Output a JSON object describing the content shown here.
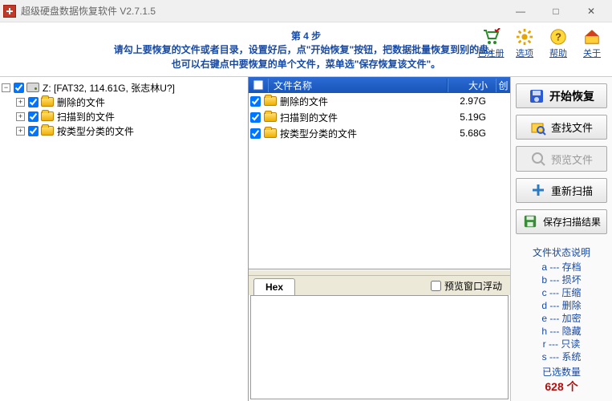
{
  "window": {
    "title": "超级硬盘数据恢复软件 V2.7.1.5",
    "min": "—",
    "max": "□",
    "close": "✕"
  },
  "step": {
    "label": "第 4 步"
  },
  "instructions": {
    "line1": "请勾上要恢复的文件或者目录，设置好后，点\"开始恢复\"按钮，把数据批量恢复到别的盘。",
    "line2": "也可以右键点中要恢复的单个文件，菜单选\"保存恢复该文件\"。"
  },
  "top_tools": [
    {
      "id": "registered",
      "label": "已注册"
    },
    {
      "id": "options",
      "label": "选项"
    },
    {
      "id": "help",
      "label": "帮助"
    },
    {
      "id": "about",
      "label": "关于"
    }
  ],
  "tree": {
    "root": {
      "label": "Z:  [FAT32, 114.61G, 张志林U?]"
    },
    "children": [
      {
        "label": "删除的文件"
      },
      {
        "label": "扫描到的文件"
      },
      {
        "label": "按类型分类的文件"
      }
    ]
  },
  "list": {
    "headers": {
      "name": "文件名称",
      "size": "大小",
      "more": "创"
    },
    "rows": [
      {
        "name": "删除的文件",
        "size": "2.97G"
      },
      {
        "name": "扫描到的文件",
        "size": "5.19G"
      },
      {
        "name": "按类型分类的文件",
        "size": "5.68G"
      }
    ]
  },
  "hex": {
    "tab": "Hex",
    "float_label": "预览窗口浮动"
  },
  "actions": {
    "start": "开始恢复",
    "find": "查找文件",
    "preview": "预览文件",
    "rescan": "重新扫描",
    "save_scan": "保存扫描结果"
  },
  "legend": {
    "title": "文件状态说明",
    "items": [
      {
        "k": "a",
        "v": "存档"
      },
      {
        "k": "b",
        "v": "损坏"
      },
      {
        "k": "c",
        "v": "压缩"
      },
      {
        "k": "d",
        "v": "删除"
      },
      {
        "k": "e",
        "v": "加密"
      },
      {
        "k": "h",
        "v": "隐藏"
      },
      {
        "k": "r",
        "v": "只读"
      },
      {
        "k": "s",
        "v": "系统"
      }
    ],
    "sep": " --- ",
    "selected_label": "已选数量",
    "selected_value": "628 个"
  }
}
